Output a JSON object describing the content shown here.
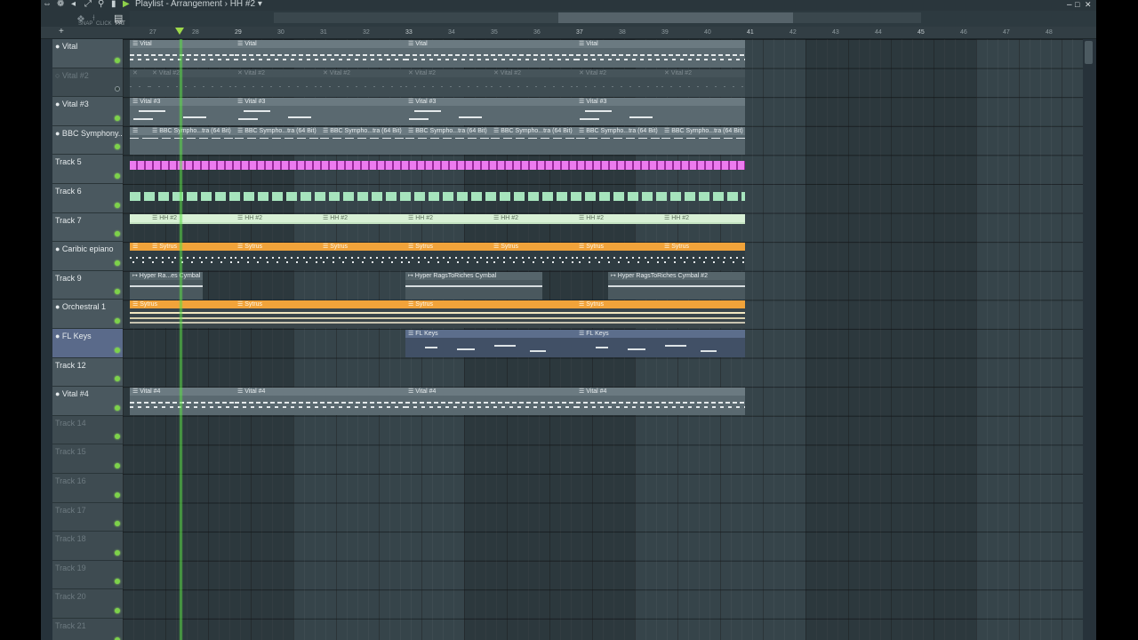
{
  "window": {
    "title": "Playlist - Arrangement › HH #2 ▾",
    "controls": [
      "–",
      "□",
      "✕"
    ]
  },
  "toolbar": {
    "tools": [
      "⇹",
      "☩",
      "◀",
      "⤢",
      "⌕",
      "◐",
      "▶"
    ],
    "labels": [
      "SNAP",
      "CLICK",
      "PAT"
    ],
    "add_track": "+"
  },
  "ruler": {
    "bars": [
      "27",
      "28",
      "29",
      "30",
      "31",
      "32",
      "33",
      "34",
      "35",
      "36",
      "37",
      "38",
      "39",
      "40",
      "41",
      "42",
      "43",
      "44",
      "45",
      "46",
      "47",
      "48"
    ]
  },
  "tracks": [
    {
      "name": "● Vital",
      "empty": false
    },
    {
      "name": "○ Vital #2",
      "empty": true,
      "muted": true
    },
    {
      "name": "● Vital #3",
      "empty": false
    },
    {
      "name": "● BBC Symphony...",
      "empty": false
    },
    {
      "name": "Track 5",
      "empty": false
    },
    {
      "name": "Track 6",
      "empty": false
    },
    {
      "name": "Track 7",
      "empty": false
    },
    {
      "name": "● Caribic epiano",
      "empty": false
    },
    {
      "name": "Track 9",
      "empty": false
    },
    {
      "name": "● Orchestral 1",
      "empty": false
    },
    {
      "name": "● FL Keys",
      "empty": false,
      "selected": true
    },
    {
      "name": "Track 12",
      "empty": false
    },
    {
      "name": "● Vital #4",
      "empty": false
    },
    {
      "name": "Track 14",
      "empty": true
    },
    {
      "name": "Track 15",
      "empty": true
    },
    {
      "name": "Track 16",
      "empty": true
    },
    {
      "name": "Track 17",
      "empty": true
    },
    {
      "name": "Track 18",
      "empty": true
    },
    {
      "name": "Track 19",
      "empty": true
    },
    {
      "name": "Track 20",
      "empty": true
    },
    {
      "name": "Track 21",
      "empty": true
    }
  ],
  "clips": {
    "vital": "☰ Vital",
    "vital2": "✕ Vital #2",
    "vital3": "☰ Vital #3",
    "bbc": "☰ BBC Sympho...tra (64 Bit)",
    "hh": "☰ HH #2",
    "sytrus": "☰ Sytrus",
    "cymbal_short": "↦ Hyper Ra...es Cymbal",
    "cymbal": "↦ Hyper RagsToRiches Cymbal",
    "cymbal2": "↦ Hyper RagsToRiches Cymbal #2",
    "flkeys": "☰ FL Keys",
    "vital4": "☰ Vital #4"
  }
}
